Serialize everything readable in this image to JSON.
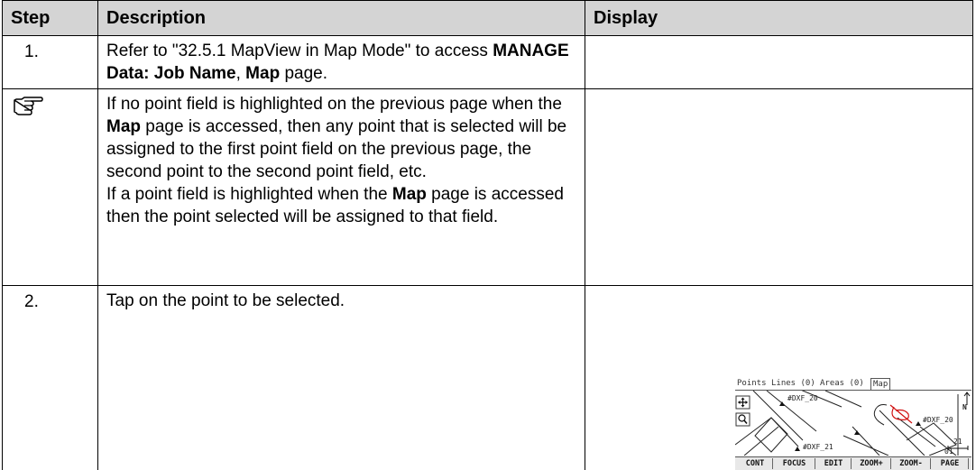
{
  "table": {
    "headers": {
      "step": "Step",
      "description": "Description",
      "display": "Display"
    },
    "row1": {
      "step": "1.",
      "text_before": "Refer to \"32.5.1 MapView in Map Mode\" to access ",
      "bold1": "MANAGE Data: Job Name",
      "sep": ", ",
      "bold2": "Map",
      "text_after": " page."
    },
    "note": {
      "icon": "pointing-hand-icon",
      "p1_before": "If no point field is highlighted on the previous page when the ",
      "p1_bold": "Map",
      "p1_after": " page is accessed, then any point that is selected will be assigned to the first point field on the previous page, the second point to the second point field, etc.",
      "p2_before": "If a point field is highlighted when the ",
      "p2_bold": "Map",
      "p2_after": " page is accessed then the point selected will be assigned to that field."
    },
    "row2": {
      "step": "2.",
      "text": "Tap on the point to be selected."
    }
  },
  "device": {
    "tabs": [
      "Points",
      "Lines (0)",
      "Areas (0)",
      "Map"
    ],
    "labels": {
      "dxf_top": "#DXF_20",
      "dxf_right": "#DXF_20",
      "dxf_bottom": "#DXF_21"
    },
    "north": "N",
    "scale": "21",
    "status": "01",
    "softkeys": [
      "CONT",
      "FOCUS",
      "EDIT",
      "ZOOM+",
      "ZOOM-",
      "PAGE"
    ]
  }
}
